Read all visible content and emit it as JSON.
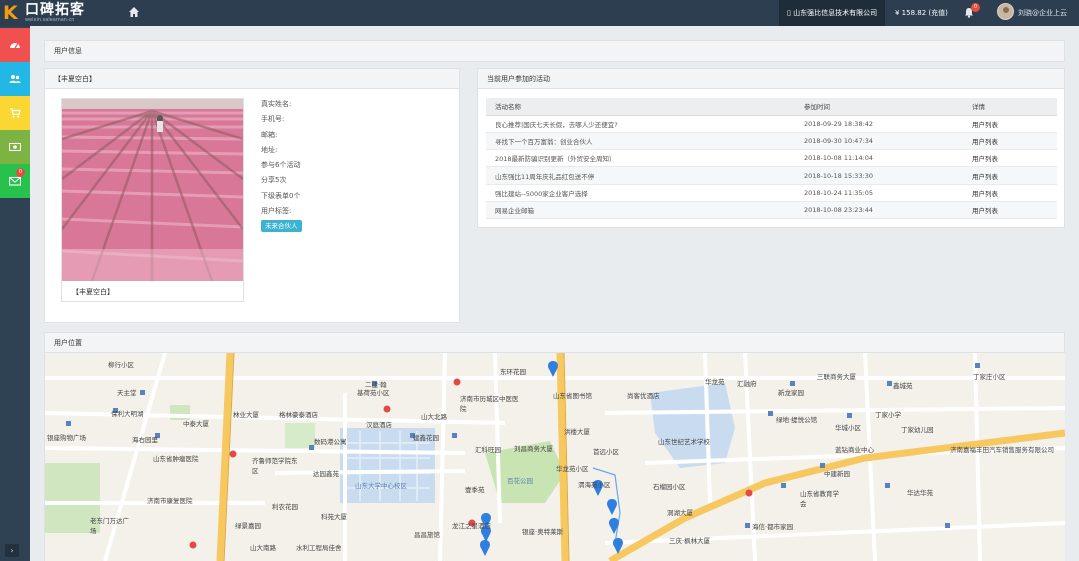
{
  "header": {
    "logo_text": "口碑拓客",
    "logo_sub": "weixin.saleaman.cn",
    "company": "山东强比信息技术有限公司",
    "balance": "¥ 158.82 (充值)",
    "notification_count": "0",
    "user": "刘骁@企业上云"
  },
  "sidebar": {
    "items": [
      {
        "icon": "dashboard-icon",
        "color": "#f05050"
      },
      {
        "icon": "users-icon",
        "color": "#23b7e5"
      },
      {
        "icon": "cart-icon",
        "color": "#fad733"
      },
      {
        "icon": "money-icon",
        "color": "#7cb342"
      },
      {
        "icon": "mail-icon",
        "color": "#27c24c",
        "badge": "0"
      }
    ],
    "toggle": "›"
  },
  "user_info": {
    "title": "用户信息",
    "card_title": "【丰夏空白】",
    "photo_caption": "【丰夏空白】",
    "fields": [
      "真实姓名:",
      "手机号:",
      "邮箱:",
      "地址:",
      "参与6个活动",
      "分享5次",
      "下级表单0个",
      "用户标签:"
    ],
    "tag": "未来合伙人"
  },
  "activities": {
    "title": "当前用户参加的活动",
    "columns": [
      "活动名称",
      "参加时间",
      "详情"
    ],
    "rows": [
      {
        "name": "良心推荐|国庆七天长假，去哪人少还便宜?",
        "time": "2018-09-29 18:38:42",
        "detail": "用户列表"
      },
      {
        "name": "寻找下一个百万富翁：创业合伙人",
        "time": "2018-09-30 10:47:34",
        "detail": "用户列表"
      },
      {
        "name": "2018最新防骗识别更新（外贸安全周知）",
        "time": "2018-10-08 11:14:04",
        "detail": "用户列表"
      },
      {
        "name": "山东强比11周年庆礼品红包送不停",
        "time": "2018-10-18 15:33:30",
        "detail": "用户列表"
      },
      {
        "name": "强比建站--5000家企业客户选择",
        "time": "2018-10-24 11:35:05",
        "detail": "用户列表"
      },
      {
        "name": "网易企业邮箱",
        "time": "2018-10-08 23:23:44",
        "detail": "用户列表"
      }
    ]
  },
  "location": {
    "title": "用户位置",
    "places": [
      "柳行小区",
      "天主堂",
      "保利大明湖",
      "银座购物广场",
      "海右园里",
      "中泰大厦",
      "林业大厦",
      "格林豪泰酒店",
      "二建·翰",
      "基荷苑小区",
      "济南市历城区中医医院",
      "东环花园",
      "山东省图书馆",
      "尚客优酒店",
      "华龙苑",
      "汇融府",
      "三联商务大厦",
      "鑫城苑",
      "丁家庄小区",
      "新龙家园",
      "山大北路",
      "汉庭酒店",
      "数码港公寓",
      "建鑫花园",
      "汇科旺园",
      "洪楼大厦",
      "刘昌商务大厦",
      "首远小区",
      "山东世纪艺术学校",
      "绿地·缇悦公馆",
      "华城小区",
      "丁家小学",
      "丁家幼儿园",
      "山东省肿瘤医院",
      "齐鲁师范学院东区",
      "达园鑫苑",
      "百花公园",
      "济南嘉福丰田汽车销售服务有限公司",
      "济南市康复医院",
      "利农花园",
      "科苑大厦",
      "壹季苑",
      "昌昌旅馆",
      "银座·奥特莱斯",
      "龙江之星酒店",
      "山东大学中心校区",
      "华龙苑小区",
      "渭海苑小区",
      "石榴园小区",
      "蓝钻商业中心",
      "山东省教育学会",
      "中建新园",
      "华达华苑",
      "海信·都市家园",
      "三庆·枫林大厦",
      "洞湖大厦",
      "山大南路",
      "水利工程局佳舍",
      "绿景嘉园",
      "老东门万达广场"
    ]
  }
}
